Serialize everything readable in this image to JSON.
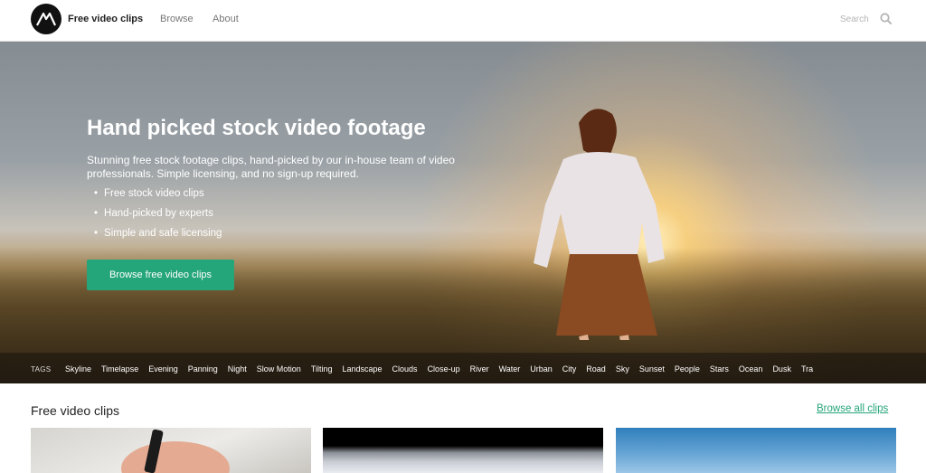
{
  "nav": {
    "brand": "Free video clips",
    "links": [
      "Browse",
      "About"
    ],
    "search_label": "Search"
  },
  "hero": {
    "title": "Hand picked stock video footage",
    "description": "Stunning free stock footage clips, hand-picked by our in-house team of video professionals. Simple licensing, and no sign-up required.",
    "bullets": [
      "Free stock video clips",
      "Hand-picked by experts",
      "Simple and safe licensing"
    ],
    "cta": "Browse free video clips"
  },
  "tags": {
    "label": "TAGS",
    "items": [
      "Skyline",
      "Timelapse",
      "Evening",
      "Panning",
      "Night",
      "Slow Motion",
      "Tilting",
      "Landscape",
      "Clouds",
      "Close-up",
      "River",
      "Water",
      "Urban",
      "City",
      "Road",
      "Sky",
      "Sunset",
      "People",
      "Stars",
      "Ocean",
      "Dusk",
      "Tra"
    ]
  },
  "section": {
    "title": "Free video clips",
    "browse_all": "Browse all clips"
  },
  "colors": {
    "accent": "#25a57a"
  }
}
